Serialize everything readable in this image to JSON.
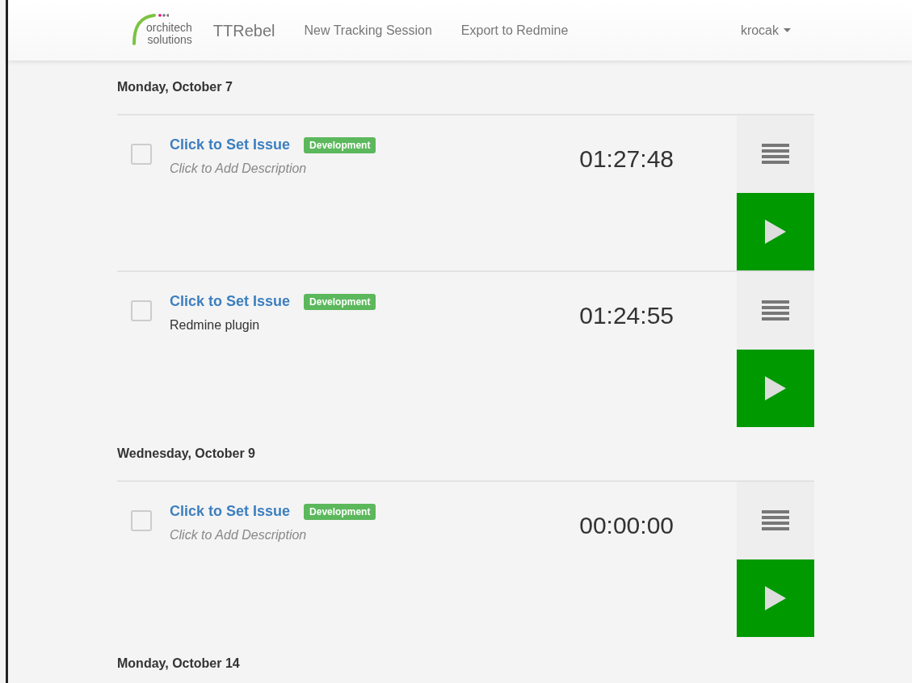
{
  "navbar": {
    "logo": {
      "line_1": "orchitech",
      "line_2": "solutions"
    },
    "brand": "TTRebel",
    "links": [
      "New Tracking Session",
      "Export to Redmine"
    ],
    "user": "krocak"
  },
  "days": [
    {
      "heading": "Monday, October 7",
      "entries": [
        {
          "issue": "Click to Set Issue",
          "tag": "Development",
          "description": {
            "placeholder": "Click to Add Description"
          },
          "time": "01:27:48",
          "checked": false
        },
        {
          "issue": "Click to Set Issue",
          "tag": "Development",
          "description": {
            "value": "Redmine plugin"
          },
          "time": "01:24:55",
          "checked": false
        }
      ]
    },
    {
      "heading": "Wednesday, October 9",
      "entries": [
        {
          "issue": "Click to Set Issue",
          "tag": "Development",
          "description": {
            "placeholder": "Click to Add Description"
          },
          "time": "00:00:00",
          "checked": false
        }
      ]
    },
    {
      "heading": "Monday, October 14"
    }
  ]
}
